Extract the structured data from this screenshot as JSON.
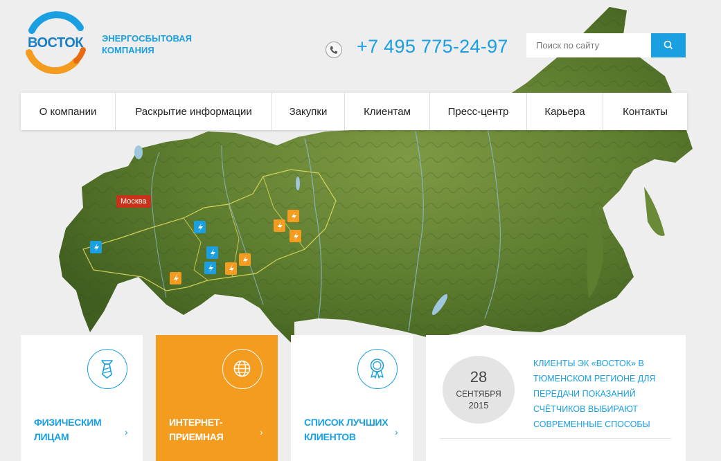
{
  "colors": {
    "accent": "#1aa0e0",
    "orange": "#f39c1f",
    "city_marker": "#c8321a"
  },
  "logo": {
    "text": "ВОСТОК",
    "subtitle_line1": "ЭНЕРГОСБЫТОВАЯ",
    "subtitle_line2": "КОМПАНИЯ"
  },
  "header": {
    "phone_icon": "phone-icon",
    "phone": "+7 495 775-24-97",
    "search_placeholder": "Поиск по сайту",
    "search_icon": "search-icon"
  },
  "nav": {
    "items": [
      {
        "label": "О компании"
      },
      {
        "label": "Раскрытие информации"
      },
      {
        "label": "Закупки"
      },
      {
        "label": "Клиентам"
      },
      {
        "label": "Пресс-центр"
      },
      {
        "label": "Карьера"
      },
      {
        "label": "Контакты"
      }
    ]
  },
  "map": {
    "city_label": "Москва"
  },
  "tiles": [
    {
      "label": "Физическим лицам",
      "icon": "tie-icon"
    },
    {
      "label": "Интернет-приемная",
      "icon": "globe-icon"
    },
    {
      "label": "Список лучших клиентов",
      "icon": "award-icon"
    }
  ],
  "tile_arrow": "›",
  "news": {
    "day": "28",
    "month": "Сентября",
    "year": "2015",
    "title": "Клиенты ЭК «Восток» в Тюменском регионе для передачи показаний счётчиков выбирают современные способы"
  }
}
